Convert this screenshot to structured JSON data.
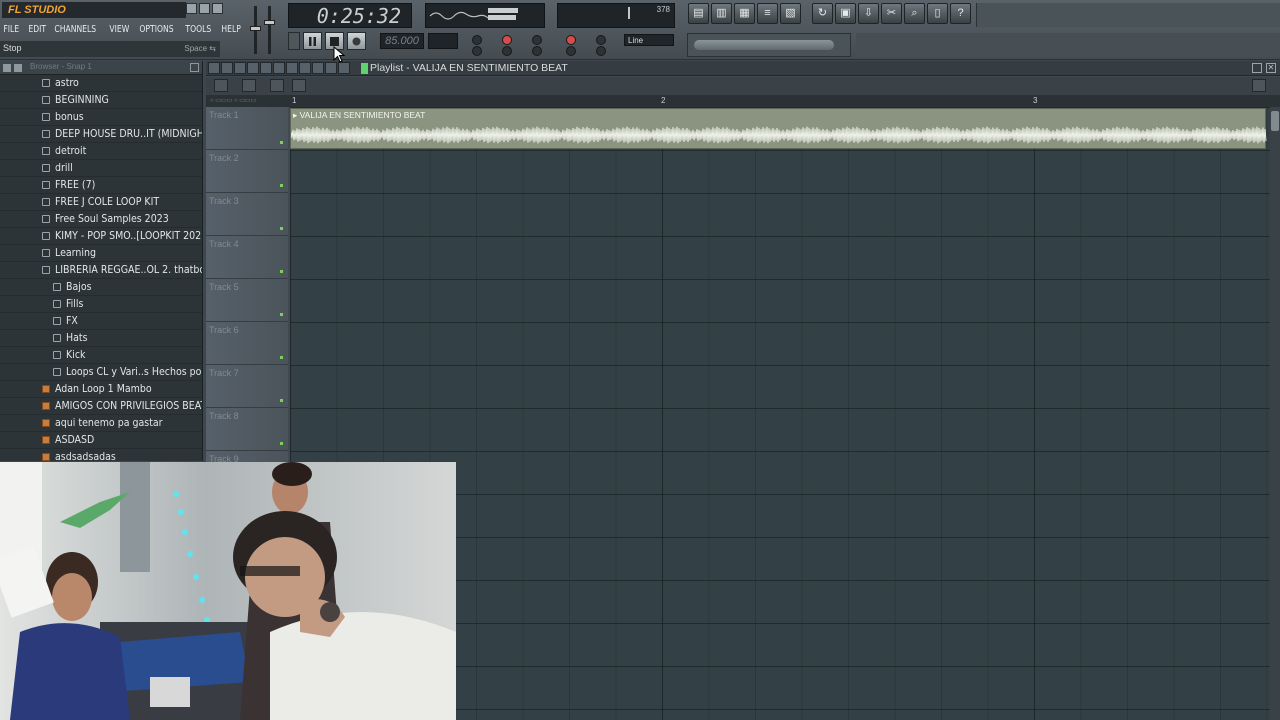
{
  "app": {
    "logo": "FL STUDIO",
    "menu": [
      "FILE",
      "EDIT",
      "CHANNELS",
      "VIEW",
      "OPTIONS",
      "TOOLS",
      "HELP"
    ],
    "hint": "Stop",
    "hint_key": "Space ⇆"
  },
  "transport": {
    "time": "0:25:32",
    "tempo": "85.000",
    "cpu": "378",
    "snap": "Line"
  },
  "browser": {
    "title": "Browser - Snap 1",
    "items": [
      {
        "label": "astro",
        "kind": "folder",
        "level": 0
      },
      {
        "label": "BEGINNING",
        "kind": "folder",
        "level": 0
      },
      {
        "label": "bonus",
        "kind": "folder",
        "level": 0
      },
      {
        "label": "DEEP HOUSE DRU..IT (MIDNIGHT)",
        "kind": "folder",
        "level": 0
      },
      {
        "label": "detroit",
        "kind": "folder",
        "level": 0
      },
      {
        "label": "drill",
        "kind": "folder",
        "level": 0
      },
      {
        "label": "FREE (7)",
        "kind": "folder",
        "level": 0
      },
      {
        "label": "FREE J COLE LOOP KIT",
        "kind": "folder",
        "level": 0
      },
      {
        "label": "Free Soul Samples 2023",
        "kind": "folder",
        "level": 0
      },
      {
        "label": "KIMY - POP SMO..[LOOPKIT 2021]",
        "kind": "folder",
        "level": 0
      },
      {
        "label": "Learning",
        "kind": "folder",
        "level": 0
      },
      {
        "label": "LIBRERIA REGGAE..OL 2. thatboyr",
        "kind": "folder",
        "level": 0
      },
      {
        "label": "Bajos",
        "kind": "folder",
        "level": 1
      },
      {
        "label": "Fills",
        "kind": "folder",
        "level": 1
      },
      {
        "label": "FX",
        "kind": "folder",
        "level": 1
      },
      {
        "label": "Hats",
        "kind": "folder",
        "level": 1
      },
      {
        "label": "Kick",
        "kind": "folder",
        "level": 1
      },
      {
        "label": "Loops CL y Vari..s Hechos por R",
        "kind": "folder",
        "level": 1
      },
      {
        "label": "Adan Loop 1 Mambo",
        "kind": "file",
        "level": 0
      },
      {
        "label": "AMIGOS CON PRIVILEGIOS BEAT",
        "kind": "file",
        "level": 0
      },
      {
        "label": "aqui tenemo pa gastar",
        "kind": "file",
        "level": 0
      },
      {
        "label": "ASDASD",
        "kind": "file",
        "level": 0
      },
      {
        "label": "asdsadsadas",
        "kind": "file",
        "level": 0
      }
    ]
  },
  "playlist": {
    "title": "Playlist - VALIJA EN SENTIMIENTO  BEAT",
    "bar_numbers": [
      "1",
      "2",
      "3"
    ],
    "tracks": [
      "Track 1",
      "Track 2",
      "Track 3",
      "Track 4",
      "Track 5",
      "Track 6",
      "Track 7",
      "Track 8",
      "Track 9"
    ],
    "clip_label": "VALIJA EN SENTIMIENTO  BEAT"
  },
  "colors": {
    "accent": "#f2a435",
    "clip": "#8a9481",
    "grid": "#334045"
  }
}
